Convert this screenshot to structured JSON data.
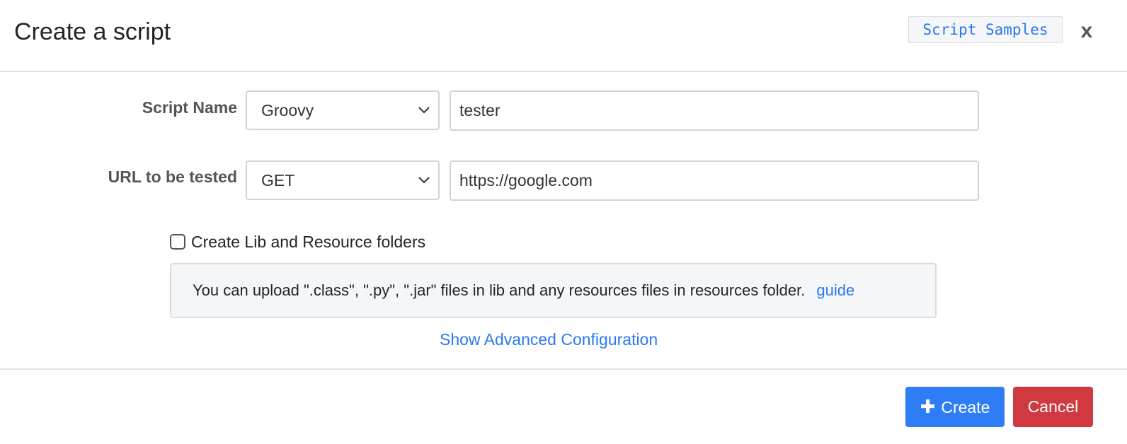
{
  "header": {
    "title": "Create a script",
    "samples_label": "Script Samples",
    "close_label": "x"
  },
  "form": {
    "script_name": {
      "label": "Script Name",
      "language_selected": "Groovy",
      "name_value": "tester"
    },
    "url": {
      "label": "URL to be tested",
      "method_selected": "GET",
      "url_value": "https://google.com"
    },
    "lib_checkbox": {
      "label": "Create Lib and Resource folders",
      "checked": false
    },
    "info": {
      "text": "You can upload \".class\", \".py\", \".jar\" files in lib and any resources files in resources folder.",
      "guide_label": "guide"
    },
    "advanced_label": "Show Advanced Configuration"
  },
  "footer": {
    "create_label": "Create",
    "create_icon": "plus-icon",
    "cancel_label": "Cancel"
  },
  "colors": {
    "primary": "#2f7df6",
    "danger": "#d0393f",
    "link": "#2b78f0"
  }
}
